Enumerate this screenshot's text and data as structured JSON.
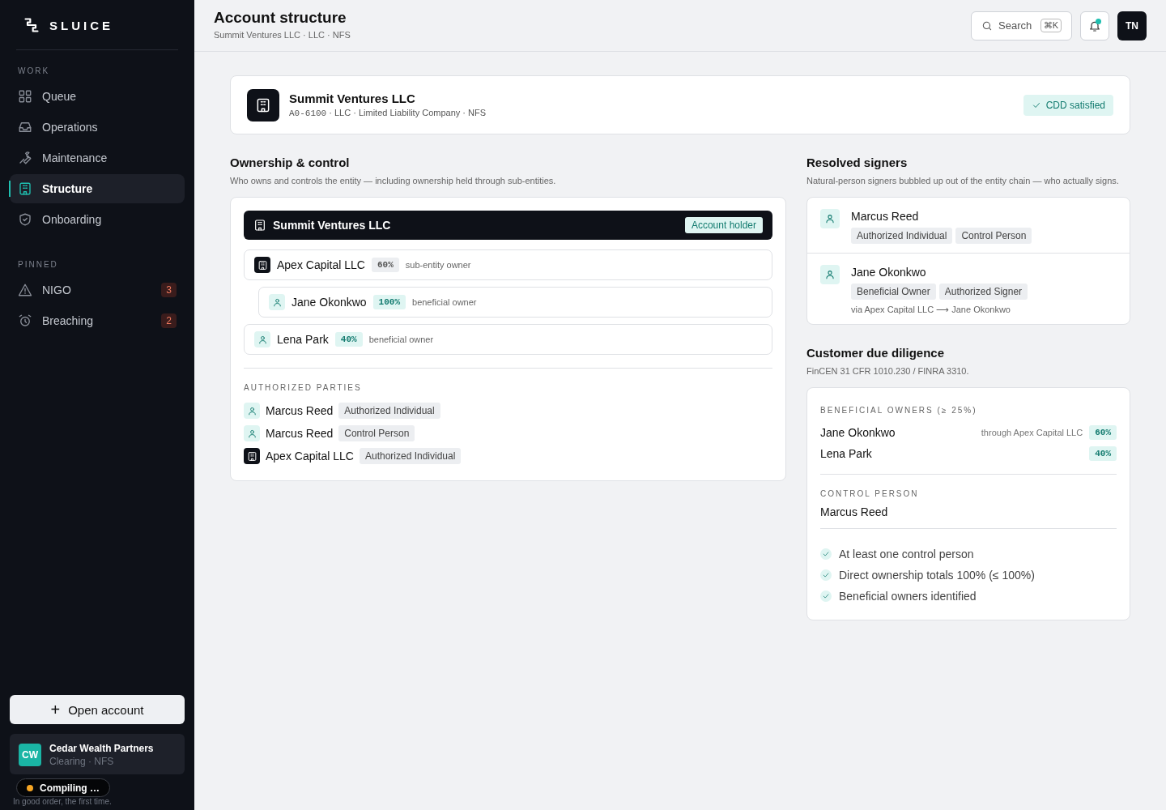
{
  "sidebar": {
    "brand": "SLUICE",
    "sections": [
      {
        "title": "WORK",
        "items": [
          {
            "label": "Queue",
            "selected": false
          },
          {
            "label": "Operations",
            "selected": false
          },
          {
            "label": "Maintenance",
            "selected": false
          },
          {
            "label": "Structure",
            "selected": true
          },
          {
            "label": "Onboarding",
            "selected": false
          }
        ]
      },
      {
        "title": "PINNED",
        "items": [
          {
            "label": "NIGO",
            "selected": false,
            "badge": "3"
          },
          {
            "label": "Breaching",
            "selected": false,
            "badge": "2"
          }
        ]
      }
    ],
    "open_account_button": {
      "icon": "+",
      "label": "Open account"
    },
    "account": {
      "initials": "CW",
      "name": "Cedar Wealth Partners",
      "subtitle": "Clearing · NFS"
    },
    "tagline": "In good order, the first time.",
    "toast": {
      "label": "Compiling …"
    }
  },
  "header": {
    "title": "Account structure",
    "subtitle": "Summit Ventures LLC · LLC · NFS",
    "search": {
      "placeholder": "Search",
      "shortcut": "⌘K"
    },
    "notifications": {
      "unread": true
    },
    "avatar": "TN"
  },
  "entity": {
    "name": "Summit Ventures LLC",
    "code": "A0-6100",
    "details": " · LLC · Limited Liability Company · NFS",
    "status": "CDD satisfied"
  },
  "ownership": {
    "title": "Ownership & control",
    "description": "Who owns and controls the entity — including ownership held through sub-entities.",
    "root": {
      "name": "Summit Ventures LLC",
      "badge": "Account holder"
    },
    "owners": [
      {
        "kind": "entity",
        "name": "Apex Capital LLC",
        "share": "60%",
        "role": "sub-entity owner",
        "children": [
          {
            "kind": "person",
            "name": "Jane Okonkwo",
            "share": "100%",
            "role": "beneficial owner"
          }
        ]
      },
      {
        "kind": "person",
        "name": "Lena Park",
        "share": "40%",
        "role": "beneficial owner"
      }
    ],
    "authorized_title": "AUTHORIZED PARTIES",
    "authorized": [
      {
        "kind": "person",
        "name": "Marcus Reed",
        "role": "Authorized Individual"
      },
      {
        "kind": "person",
        "name": "Marcus Reed",
        "role": "Control Person"
      },
      {
        "kind": "entity",
        "name": "Apex Capital LLC",
        "role": "Authorized Individual"
      }
    ]
  },
  "signers": {
    "title": "Resolved signers",
    "description": "Natural-person signers bubbled up out of the entity chain — who actually signs.",
    "items": [
      {
        "name": "Marcus Reed",
        "tags": [
          "Authorized Individual",
          "Control Person"
        ]
      },
      {
        "name": "Jane Okonkwo",
        "tags": [
          "Beneficial Owner",
          "Authorized Signer"
        ],
        "via": "via Apex Capital LLC ⟶ Jane Okonkwo"
      }
    ]
  },
  "cdd": {
    "title": "Customer due diligence",
    "description": "FinCEN 31 CFR 1010.230 / FINRA 3310.",
    "owners_title": "BENEFICIAL OWNERS (≥ 25%)",
    "owners": [
      {
        "name": "Jane Okonkwo",
        "via": "through Apex Capital LLC",
        "share": "60%"
      },
      {
        "name": "Lena Park",
        "share": "40%"
      }
    ],
    "control_title": "CONTROL PERSON",
    "control": [
      "Marcus Reed"
    ],
    "checks": [
      {
        "label": "At least one control person",
        "passed": true
      },
      {
        "label": "Direct ownership totals 100% (≤ 100%)",
        "passed": true
      },
      {
        "label": "Beneficial owners identified",
        "passed": true
      }
    ]
  }
}
